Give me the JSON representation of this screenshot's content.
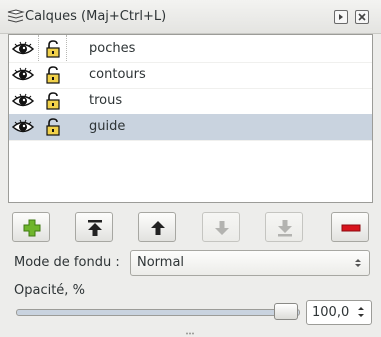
{
  "window": {
    "title": "Calques (Maj+Ctrl+L)",
    "title_icon": "layers-icon",
    "buttons": [
      "attach-icon",
      "close-icon"
    ]
  },
  "layers": [
    {
      "name": "poches",
      "visible": true,
      "locked": false,
      "selected": false
    },
    {
      "name": "contours",
      "visible": true,
      "locked": false,
      "selected": false
    },
    {
      "name": "trous",
      "visible": true,
      "locked": false,
      "selected": false
    },
    {
      "name": "guide",
      "visible": true,
      "locked": false,
      "selected": true
    }
  ],
  "actions": [
    {
      "id": "add-layer",
      "icon": "plus-icon",
      "enabled": true
    },
    {
      "id": "raise-to-top",
      "icon": "raise-to-top-icon",
      "enabled": true
    },
    {
      "id": "raise",
      "icon": "arrow-up-icon",
      "enabled": true
    },
    {
      "id": "lower",
      "icon": "arrow-down-icon",
      "enabled": false
    },
    {
      "id": "lower-to-bottom",
      "icon": "lower-to-bottom-icon",
      "enabled": false
    },
    {
      "id": "delete-layer",
      "icon": "minus-icon",
      "enabled": true
    }
  ],
  "blend": {
    "label": "Mode de fondu :",
    "value": "Normal"
  },
  "opacity": {
    "label": "Opacité, %",
    "value": "100,0",
    "level": 100
  },
  "colors": {
    "selection": "#c9d3df",
    "add": "#6fb52c",
    "delete": "#d8141c"
  }
}
